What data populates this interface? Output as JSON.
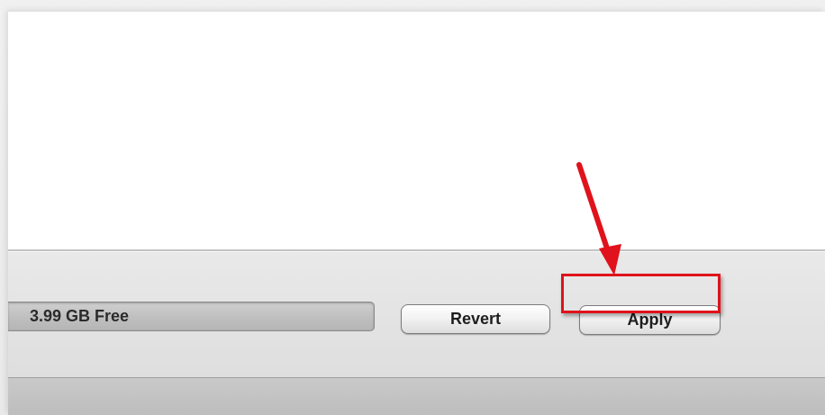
{
  "storage": {
    "free_label": "3.99 GB Free"
  },
  "buttons": {
    "revert_label": "Revert",
    "apply_label": "Apply"
  },
  "annotation": {
    "color": "#e0121b",
    "target": "Apply"
  }
}
